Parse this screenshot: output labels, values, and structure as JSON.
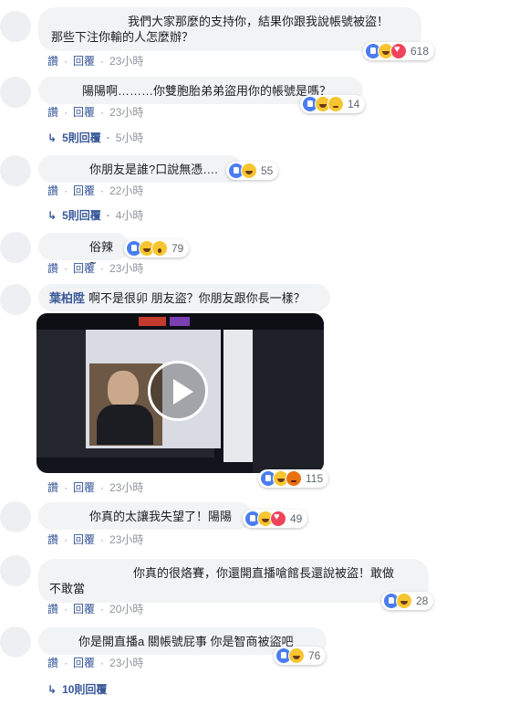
{
  "comments": [
    {
      "text": "我們大家那麼的支持你，結果你跟我說帳號被盜！\n那些下注你輸的人怎麼辦？",
      "reactions": [
        "like",
        "haha",
        "love"
      ],
      "count": "618",
      "like": "讚",
      "reply": "回覆",
      "time": "23小時"
    },
    {
      "text": "陽陽啊………你雙胞胎弟弟盜用你的帳號是嗎？",
      "reactions": [
        "like",
        "haha",
        "sad"
      ],
      "count": "14",
      "like": "讚",
      "reply": "回覆",
      "time": "23小時",
      "replies": "5則回覆",
      "replies_time": "5小時"
    },
    {
      "text": "你朋友是誰?口說無憑….",
      "reactions": [
        "like",
        "haha"
      ],
      "count": "55",
      "like": "讚",
      "reply": "回覆",
      "time": "22小時",
      "replies": "5則回覆",
      "replies_time": "4小時"
    },
    {
      "text": "俗辣~",
      "reactions": [
        "like",
        "haha",
        "wow"
      ],
      "count": "79",
      "like": "讚",
      "reply": "回覆",
      "time": "23小時"
    },
    {
      "author": "葉柏陞",
      "text": "啊不是很卯 朋友盜？你朋友跟你長一樣？",
      "reactions": [
        "like",
        "haha",
        "angry"
      ],
      "count": "115",
      "like": "讚",
      "reply": "回覆",
      "time": "23小時"
    },
    {
      "text": "你真的太讓我失望了！陽陽",
      "reactions": [
        "like",
        "haha",
        "love"
      ],
      "count": "49",
      "like": "讚",
      "reply": "回覆",
      "time": "23小時"
    },
    {
      "text": "你真的很烙賽，你還開直播嗆館長還說被盜！敢做\n不敢當",
      "reactions": [
        "like",
        "haha"
      ],
      "count": "28",
      "like": "讚",
      "reply": "回覆",
      "time": "20小時"
    },
    {
      "text": "你是開直播a 關帳號屁事 你是智商被盜吧",
      "reactions": [
        "like",
        "haha"
      ],
      "count": "76",
      "like": "讚",
      "reply": "回覆",
      "time": "23小時",
      "replies": "10則回覆"
    }
  ],
  "icons": {
    "like": "like-reaction-icon",
    "haha": "haha-reaction-icon",
    "love": "love-reaction-icon",
    "sad": "sad-reaction-icon",
    "wow": "wow-reaction-icon",
    "angry": "angry-reaction-icon",
    "play": "play-icon",
    "reply_arrow": "reply-arrow-icon"
  },
  "colors": {
    "link": "#385898",
    "bubble": "#f2f3f5",
    "meta": "#90949c"
  }
}
